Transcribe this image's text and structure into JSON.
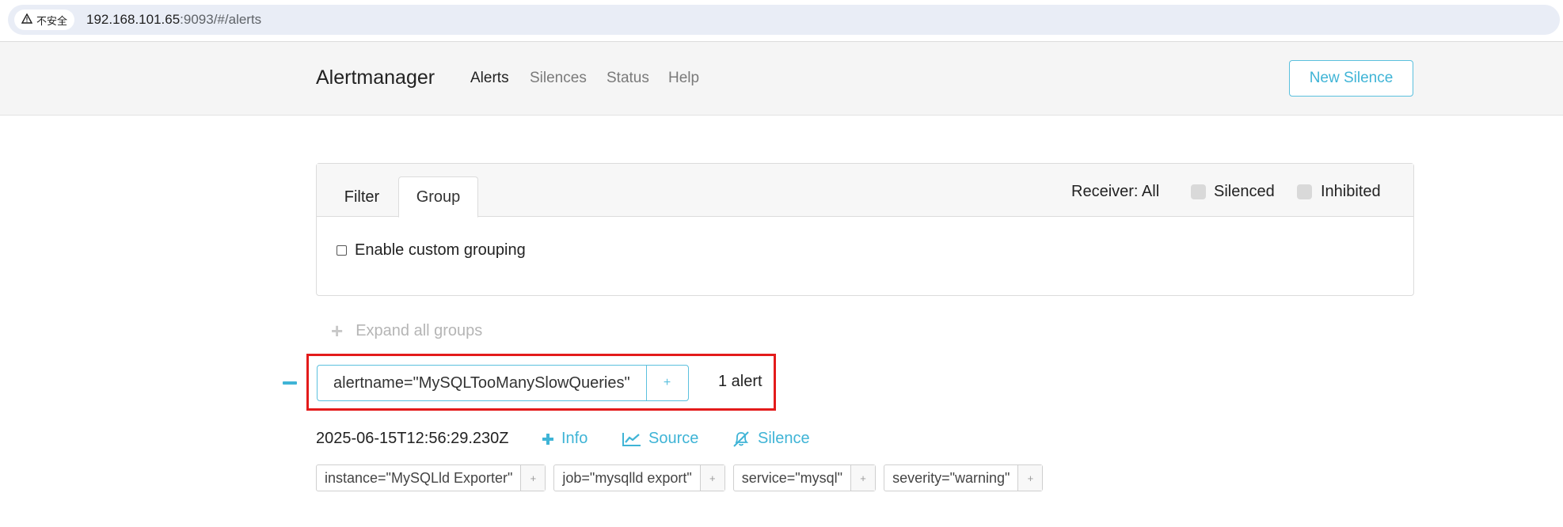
{
  "browser": {
    "security_label": "不安全",
    "url_host": "192.168.101.65",
    "url_rest": ":9093/#/alerts"
  },
  "navbar": {
    "brand": "Alertmanager",
    "items": [
      {
        "label": "Alerts",
        "active": true
      },
      {
        "label": "Silences",
        "active": false
      },
      {
        "label": "Status",
        "active": false
      },
      {
        "label": "Help",
        "active": false
      }
    ],
    "new_silence_label": "New Silence"
  },
  "filter_card": {
    "tabs": [
      {
        "label": "Filter",
        "active": false
      },
      {
        "label": "Group",
        "active": true
      }
    ],
    "receiver_label": "Receiver: All",
    "silenced_label": "Silenced",
    "inhibited_label": "Inhibited",
    "custom_grouping_label": "Enable custom grouping",
    "custom_grouping_checked": false
  },
  "expand_all": {
    "icon": "plus-icon",
    "label": "Expand all groups"
  },
  "alert_group": {
    "collapse_icon": "minus-icon",
    "label": "alertname=\"MySQLTooManySlowQueries\"",
    "add_symbol": "+",
    "count_label": "1 alert",
    "highlight_color": "#e31b1b"
  },
  "alert": {
    "timestamp": "2025-06-15T12:56:29.230Z",
    "actions": [
      {
        "icon": "plus-icon",
        "label": "Info"
      },
      {
        "icon": "chart-line-icon",
        "label": "Source"
      },
      {
        "icon": "bell-slash-icon",
        "label": "Silence"
      }
    ],
    "labels": [
      "instance=\"MySQLld Exporter\"",
      "job=\"mysqlld export\"",
      "service=\"mysql\"",
      "severity=\"warning\""
    ],
    "label_add_symbol": "+"
  },
  "colors": {
    "accent": "#3fb4d6",
    "navbar_bg": "#f5f5f5"
  }
}
